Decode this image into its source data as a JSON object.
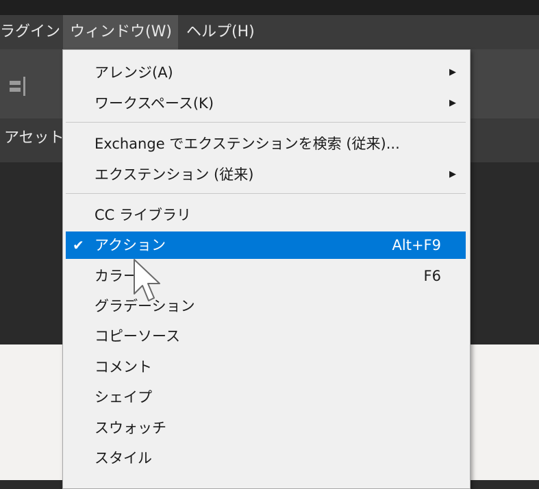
{
  "menubar": {
    "items": [
      {
        "label": "ラグイン"
      },
      {
        "label": "ウィンドウ(W)"
      },
      {
        "label": "ヘルプ(H)"
      }
    ]
  },
  "panel": {
    "tab_label": "アセット"
  },
  "window_menu": {
    "items": [
      {
        "label": "アレンジ(A)",
        "shortcut": "",
        "submenu": true
      },
      {
        "label": "ワークスペース(K)",
        "shortcut": "",
        "submenu": true
      },
      {
        "label": "Exchange でエクステンションを検索 (従来)...",
        "shortcut": "",
        "submenu": false
      },
      {
        "label": "エクステンション (従来)",
        "shortcut": "",
        "submenu": true
      },
      {
        "label": "CC ライブラリ",
        "shortcut": "",
        "submenu": false
      },
      {
        "label": "アクション",
        "shortcut": "Alt+F9",
        "submenu": false,
        "checked": true,
        "highlighted": true
      },
      {
        "label": "カラー",
        "shortcut": "F6",
        "submenu": false
      },
      {
        "label": "グラデーション",
        "shortcut": "",
        "submenu": false
      },
      {
        "label": "コピーソース",
        "shortcut": "",
        "submenu": false
      },
      {
        "label": "コメント",
        "shortcut": "",
        "submenu": false
      },
      {
        "label": "シェイプ",
        "shortcut": "",
        "submenu": false
      },
      {
        "label": "スウォッチ",
        "shortcut": "",
        "submenu": false
      },
      {
        "label": "スタイル",
        "shortcut": "",
        "submenu": false
      }
    ]
  },
  "icons": {
    "submenu": "submenu-arrow-icon",
    "check": "checkmark-icon",
    "cursor": "mouse-pointer-icon",
    "align": "align-icon"
  },
  "colors": {
    "highlight": "#0078d7",
    "menu_bg": "#f0f0f0",
    "menubar_bg": "#3b3b3b"
  }
}
